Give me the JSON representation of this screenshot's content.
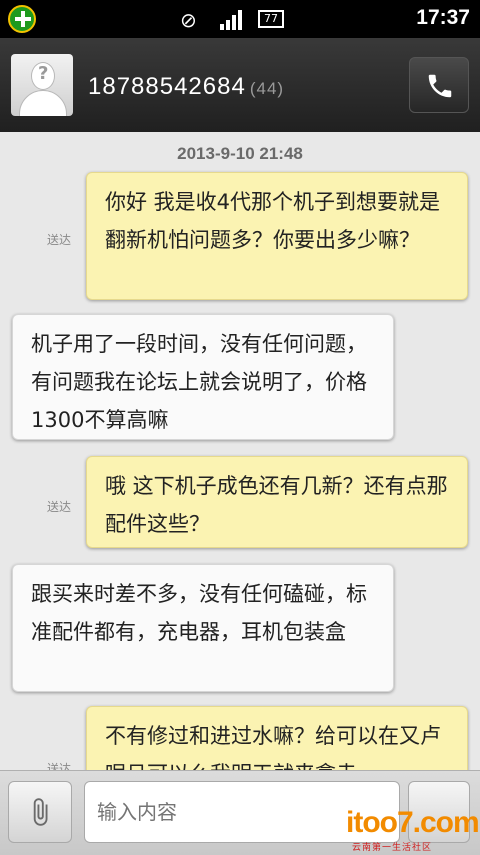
{
  "status_bar": {
    "time": "17:37",
    "battery": "77",
    "app_icon": "plus-circle-icon",
    "vibrate_icon": "vibrate-off-icon",
    "signal_icon": "signal-icon"
  },
  "header": {
    "contact_number": "18788542684",
    "message_count": "(44)",
    "avatar_icon": "unknown-contact-avatar",
    "call_icon": "phone-icon"
  },
  "conversation": {
    "timestamp": "2013-9-10 21:48",
    "sent_label": "送达",
    "messages": [
      {
        "type": "sent",
        "text": "你好 我是收4代那个机子到想要就是翻新机怕问题多？你要出多少嘛？"
      },
      {
        "type": "received",
        "text": "机子用了一段时间，没有任何问题，有问题我在论坛上就会说明了，价格1300不算高嘛"
      },
      {
        "type": "sent",
        "text": "哦 这下机子成色还有几新？还有点那配件这些？"
      },
      {
        "type": "received",
        "text": "跟买来时差不多，没有任何磕碰，标准配件都有，充电器，耳机包装盒"
      },
      {
        "type": "sent",
        "text": "不有修过和进过水嘛？给可以在又卢呢吕可以么我明天就来拿走"
      }
    ]
  },
  "composer": {
    "placeholder": "输入内容",
    "attach_icon": "paperclip-icon",
    "send_icon": "send-icon"
  },
  "watermark": {
    "logo": "itoo7.com",
    "tagline": "云南第一生活社区"
  },
  "colors": {
    "sent_bubble": "#fbf3b2",
    "received_bubble": "#fafafa",
    "header_bg": "#2c2c2c"
  }
}
